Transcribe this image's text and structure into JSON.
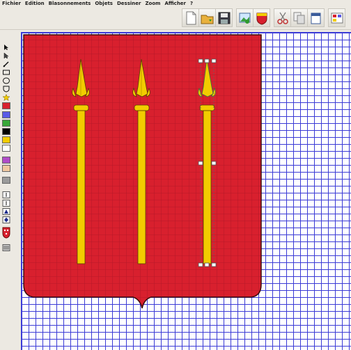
{
  "menu": [
    "Fichier",
    "Edition",
    "Blasonnements",
    "Objets",
    "Dessiner",
    "Zoom",
    "Afficher",
    "?"
  ],
  "toolbar": {
    "buttons": [
      "new-file-icon",
      "open-folder-icon",
      "save-disk-icon",
      "export-image-icon",
      "shield-icon",
      "cut-scissors-icon",
      "copy-icon",
      "paste-icon"
    ]
  },
  "tools": [
    "select-arrow-icon",
    "direct-select-icon",
    "pen-icon",
    "rectangle-icon",
    "ellipse-icon",
    "shield-shape-icon",
    "star-icon"
  ],
  "colors": {
    "gules": "#d8202e",
    "azure": "#5a5ae6",
    "vert": "#38a838",
    "sable": "#000000",
    "or": "#f2cc00",
    "argent": "#ffffff",
    "purpure": "#b04cc8",
    "carnation": "#f0c8a0",
    "grey": "#9a9a9a",
    "grid": "#3b3bd6",
    "field": "#d8202e",
    "charge": "#f2cc00"
  },
  "swatches": [
    "gules",
    "azure",
    "vert",
    "sable",
    "or",
    "argent",
    "purpure",
    "carnation",
    "grey"
  ]
}
